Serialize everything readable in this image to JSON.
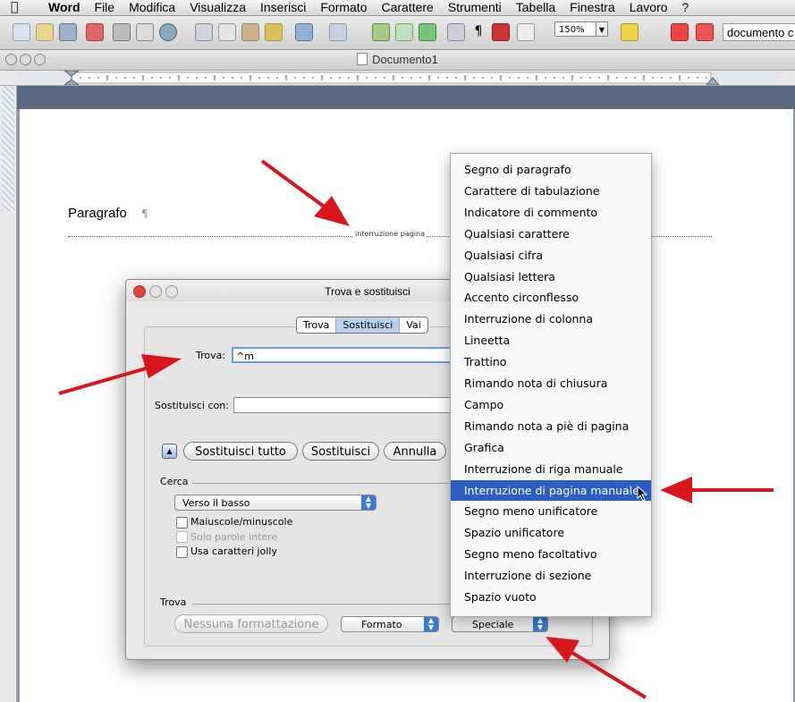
{
  "menubar": {
    "app": "Word",
    "items": [
      "File",
      "Modifica",
      "Visualizza",
      "Inserisci",
      "Formato",
      "Carattere",
      "Strumenti",
      "Tabella",
      "Finestra",
      "Lavoro",
      "?"
    ]
  },
  "toolbar": {
    "zoom": "150%",
    "search_text": "documento c"
  },
  "window": {
    "title": "Documento1"
  },
  "document": {
    "paragraph_text": "Paragrafo",
    "paragraph_mark": "¶",
    "page_break_label": "interruzione pagina"
  },
  "dialog": {
    "title": "Trova e sostituisci",
    "tabs": [
      "Trova",
      "Sostituisci",
      "Vai"
    ],
    "selected_tab": "Sostituisci",
    "find_label": "Trova:",
    "find_value": "^m",
    "replace_label": "Sostituisci con:",
    "replace_value": "",
    "buttons": {
      "replace_all": "Sostituisci tutto",
      "replace": "Sostituisci",
      "cancel": "Annulla"
    },
    "search_section": "Cerca",
    "direction": "Verso il basso",
    "options": [
      {
        "label": "Maiuscole/minuscole",
        "checked": false,
        "enabled": true
      },
      {
        "label": "Solo parole intere",
        "checked": false,
        "enabled": false
      },
      {
        "label": "Usa caratteri jolly",
        "checked": false,
        "enabled": true
      }
    ],
    "find_section": "Trova",
    "no_formatting": "Nessuna formattazione",
    "format": "Formato",
    "special": "Speciale"
  },
  "special_menu": {
    "items": [
      "Segno di paragrafo",
      "Carattere di tabulazione",
      "Indicatore di commento",
      "Qualsiasi carattere",
      "Qualsiasi cifra",
      "Qualsiasi lettera",
      "Accento circonflesso",
      "Interruzione di colonna",
      "Lineetta",
      "Trattino",
      "Rimando nota di chiusura",
      "Campo",
      "Rimando nota a piè di pagina",
      "Grafica",
      "Interruzione di riga manuale",
      "Interruzione di pagina manuale",
      "Segno meno unificatore",
      "Spazio unificatore",
      "Segno meno facoltativo",
      "Interruzione di sezione",
      "Spazio vuoto"
    ],
    "highlighted": "Interruzione di pagina manuale"
  },
  "colors": {
    "highlight": "#2a5fc1",
    "arrow": "#d9161c"
  }
}
